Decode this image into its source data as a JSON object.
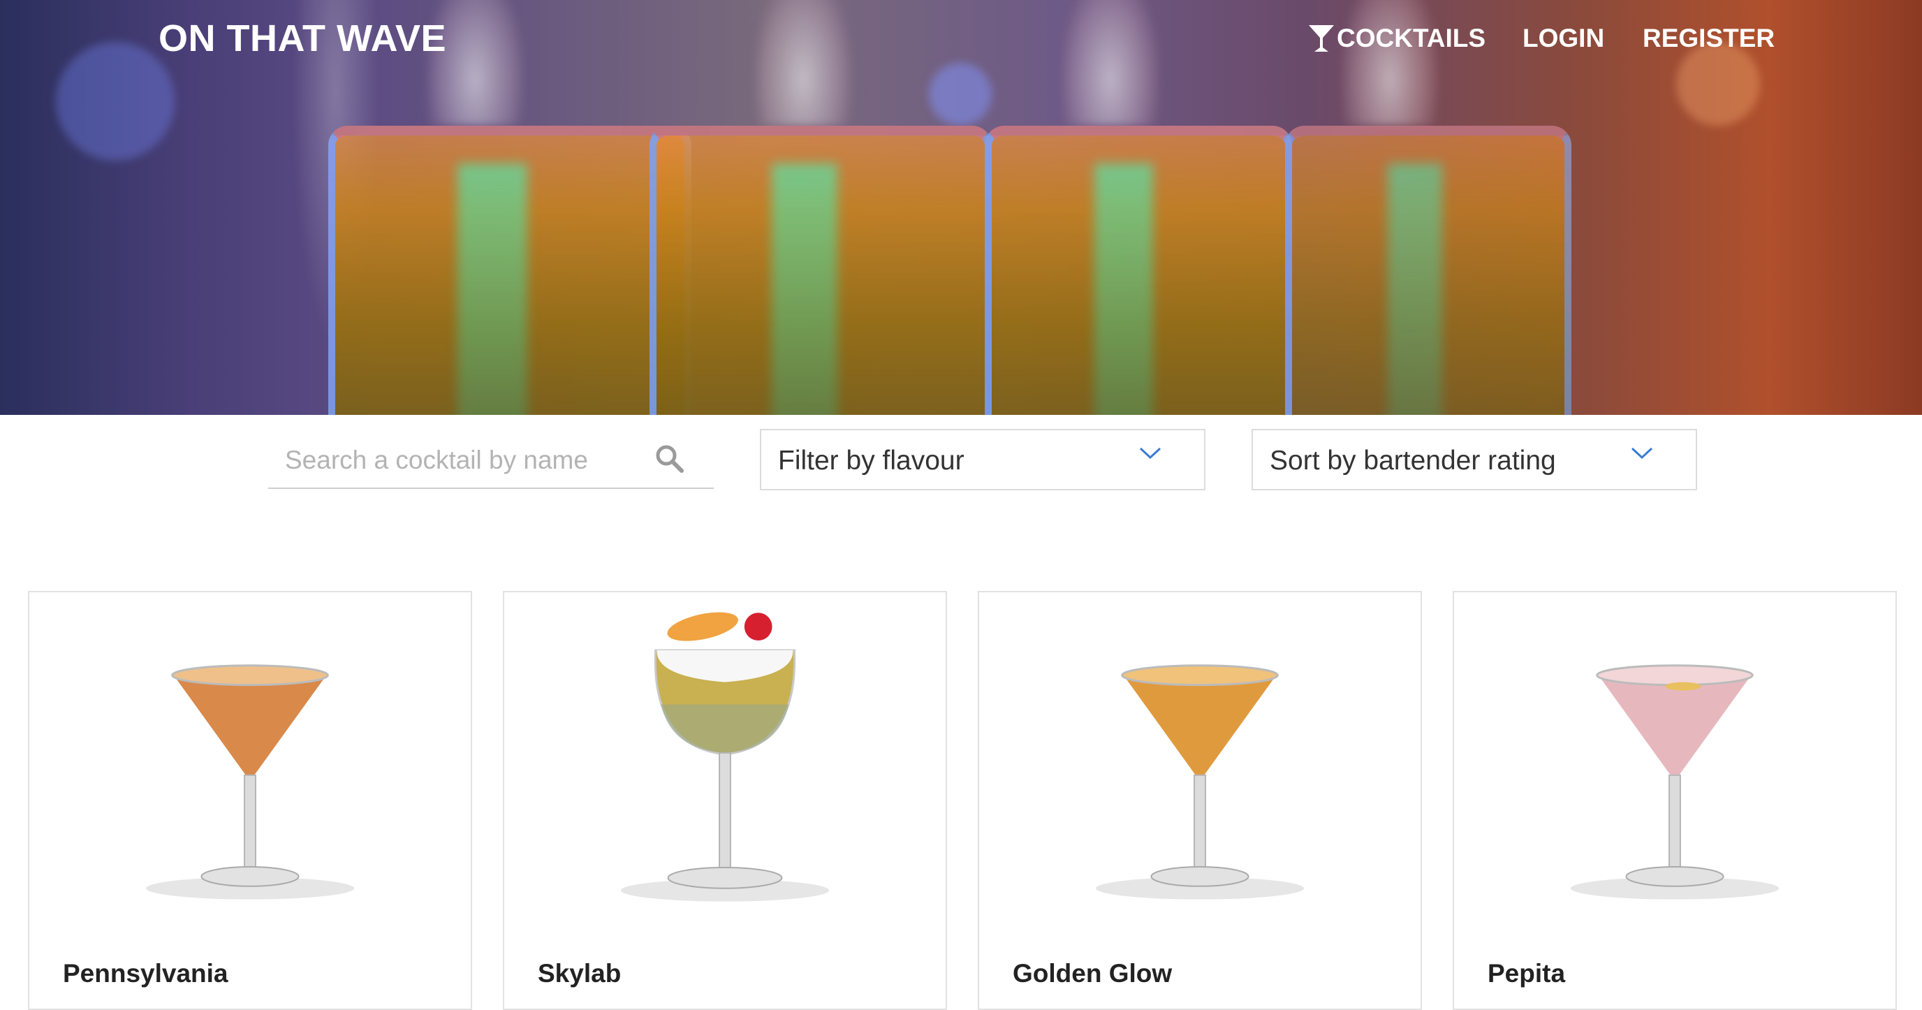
{
  "header": {
    "brand": "ON THAT WAVE",
    "nav": {
      "cocktails": "COCKTAILS",
      "login": "LOGIN",
      "register": "REGISTER"
    }
  },
  "controls": {
    "search": {
      "placeholder": "Search a cocktail by name",
      "value": ""
    },
    "flavour_filter": {
      "label": "Filter by flavour"
    },
    "sort": {
      "label": "Sort by bartender rating"
    }
  },
  "cocktails": [
    {
      "name": "Pennsylvania",
      "glass": "martini-glass",
      "color": "#d9894a"
    },
    {
      "name": "Skylab",
      "glass": "goblet-glass",
      "color": "#c9b050"
    },
    {
      "name": "Golden Glow",
      "glass": "martini-glass",
      "color": "#e09a3e"
    },
    {
      "name": "Pepita",
      "glass": "martini-glass",
      "color": "#e6b8be"
    }
  ],
  "icons": {
    "search": "search-icon",
    "cocktail": "cocktail-icon",
    "chevron": "chevron-down-icon"
  },
  "colors": {
    "chevron": "#3a7bd5",
    "border": "#dcdcdc"
  }
}
